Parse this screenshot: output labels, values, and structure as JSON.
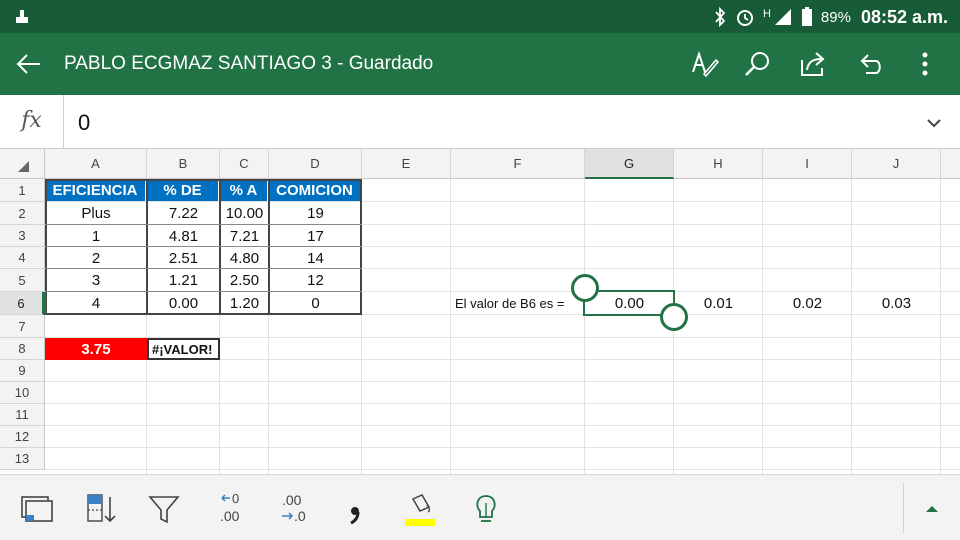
{
  "status_bar": {
    "signal_tag": "H",
    "battery": "89%",
    "time": "08:52 a.m."
  },
  "app_bar": {
    "title": "PABLO ECGMAZ SANTIAGO 3 - Guardado"
  },
  "formula_bar": {
    "fx_label": "fx",
    "value": "0"
  },
  "columns": [
    "A",
    "B",
    "C",
    "D",
    "E",
    "F",
    "G",
    "H",
    "I",
    "J"
  ],
  "selected_column": "G",
  "rows": [
    "1",
    "2",
    "3",
    "4",
    "5",
    "6",
    "7",
    "8",
    "9",
    "10",
    "11",
    "12",
    "13"
  ],
  "selected_row": "6",
  "table": {
    "headers": [
      "EFICIENCIA",
      "% DE",
      "% A",
      "COMICION"
    ],
    "rows": [
      [
        "Plus",
        "7.22",
        "10.00",
        "19"
      ],
      [
        "1",
        "4.81",
        "7.21",
        "17"
      ],
      [
        "2",
        "2.51",
        "4.80",
        "14"
      ],
      [
        "3",
        "1.21",
        "2.50",
        "12"
      ],
      [
        "4",
        "0.00",
        "1.20",
        "0"
      ]
    ]
  },
  "row8": {
    "a8": "3.75",
    "b8": "#¡VALOR!"
  },
  "row6_extra": {
    "label": "El valor de B6 es =",
    "g6": "0.00",
    "h6": "0.01",
    "i6": "0.02",
    "j6": "0.03"
  },
  "colors": {
    "excel_green": "#217346",
    "status_green": "#185c37",
    "header_blue": "#0070c0",
    "alert_red": "#ff0000",
    "fill_yellow": "#ffff00"
  },
  "toolbar_icons": [
    "freeze-panes-icon",
    "sort-icon",
    "filter-icon",
    "decrease-decimal-icon",
    "increase-decimal-icon",
    "comma-style-icon",
    "fill-color-icon",
    "tell-me-lightbulb-icon",
    "expand-ribbon-icon"
  ]
}
